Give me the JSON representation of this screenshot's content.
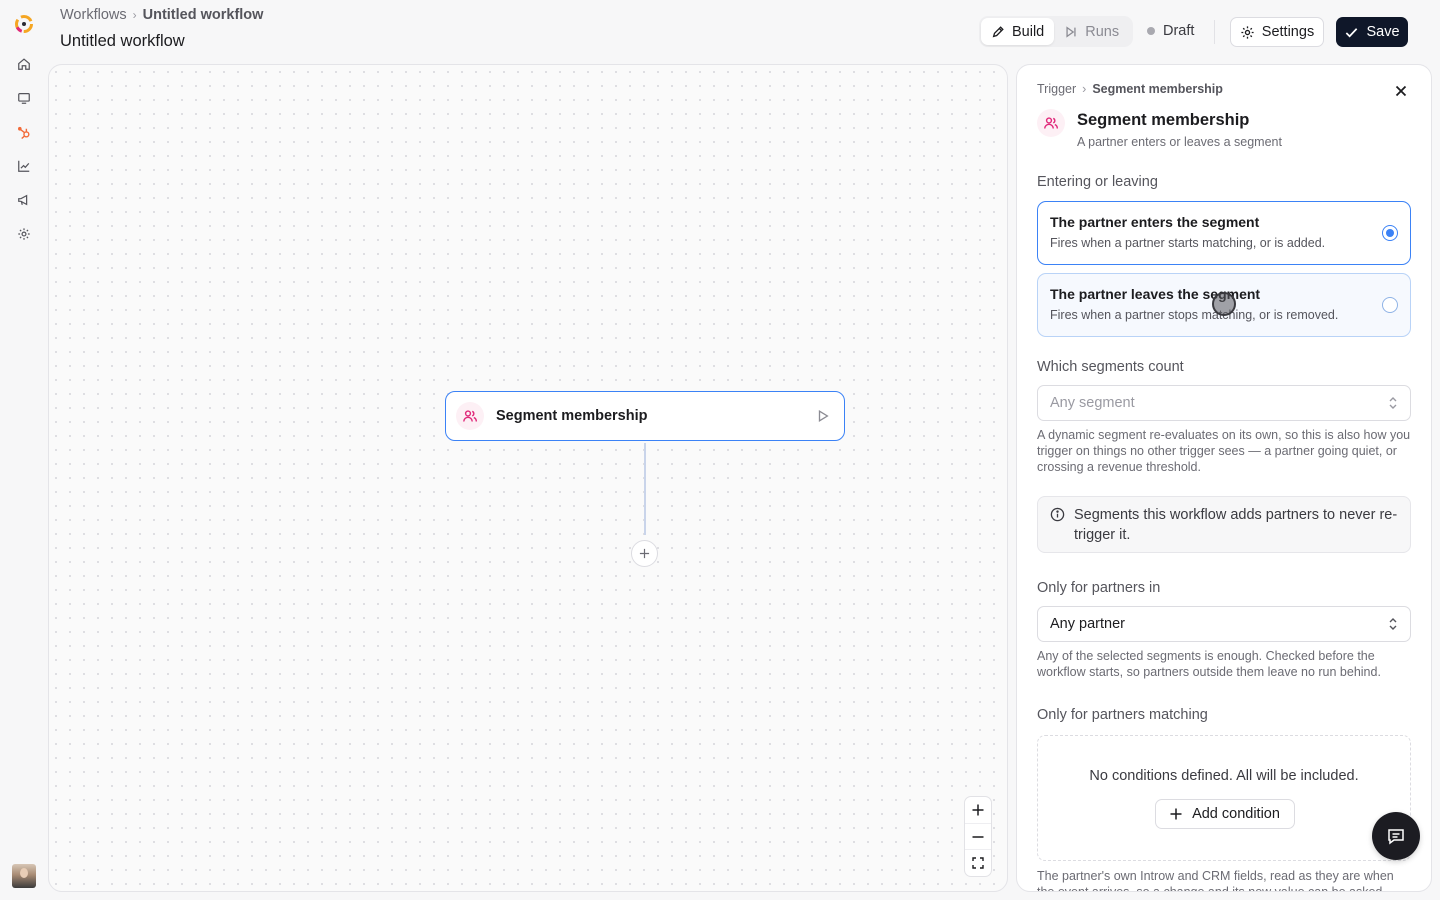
{
  "header": {
    "breadcrumb_root": "Workflows",
    "breadcrumb_current": "Untitled workflow",
    "title": "Untitled workflow",
    "tabs": [
      {
        "label": "Build",
        "icon": "pencil-icon",
        "active": true
      },
      {
        "label": "Runs",
        "icon": "run-icon",
        "active": false
      }
    ],
    "status": "Draft",
    "settings_label": "Settings",
    "save_label": "Save"
  },
  "sidebar": {
    "items": [
      {
        "name": "home",
        "icon": "home-icon"
      },
      {
        "name": "monitor",
        "icon": "monitor-icon"
      },
      {
        "name": "hubspot",
        "icon": "hubspot-icon"
      },
      {
        "name": "analytics",
        "icon": "chart-icon"
      },
      {
        "name": "campaigns",
        "icon": "megaphone-icon"
      },
      {
        "name": "settings",
        "icon": "gear-icon"
      }
    ]
  },
  "canvas": {
    "node_label": "Segment membership",
    "node_icon": "users-icon"
  },
  "panel": {
    "breadcrumb_root": "Trigger",
    "breadcrumb_current": "Segment membership",
    "title": "Segment membership",
    "subtitle": "A partner enters or leaves a segment",
    "entering_label": "Entering or leaving",
    "options": [
      {
        "title": "The partner enters the segment",
        "desc": "Fires when a partner starts matching, or is added.",
        "selected": true
      },
      {
        "title": "The partner leaves the segment",
        "desc": "Fires when a partner stops matching, or is removed.",
        "selected": false
      }
    ],
    "segments_label": "Which segments count",
    "segments_placeholder": "Any segment",
    "segments_help": "A dynamic segment re-evaluates on its own, so this is also how you trigger on things no other trigger sees — a partner going quiet, or crossing a revenue threshold.",
    "info_text": "Segments this workflow adds partners to never re-trigger it.",
    "partners_in_label": "Only for partners in",
    "partners_in_value": "Any partner",
    "partners_in_help": "Any of the selected segments is enough. Checked before the workflow starts, so partners outside them leave no run behind.",
    "matching_label": "Only for partners matching",
    "no_conditions": "No conditions defined. All will be included.",
    "add_condition": "Add condition",
    "footer_help": "The partner's own Introw and CRM fields, read as they are when the event arrives, so a change and its new value can be asked"
  },
  "colors": {
    "accent": "#3b82f6",
    "save_bg": "#0f1729",
    "trigger_icon": "#e0297a"
  }
}
